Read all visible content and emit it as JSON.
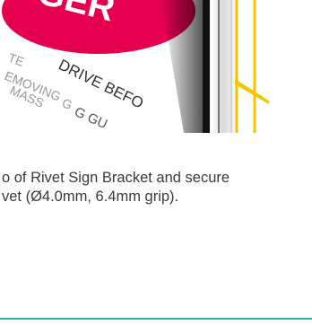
{
  "illustration": {
    "sign_text_line1": "DRIVE BEFO",
    "sign_text_line2": "G GU"
  },
  "instruction": {
    "line1": "o of Rivet Sign Bracket and secure",
    "line2": "vet (Ø4.0mm, 6.4mm grip)."
  },
  "colors": {
    "sign_red": "#e5004f",
    "bracket_yellow": "#f2c600",
    "divider_teal": "#2bb39c"
  }
}
